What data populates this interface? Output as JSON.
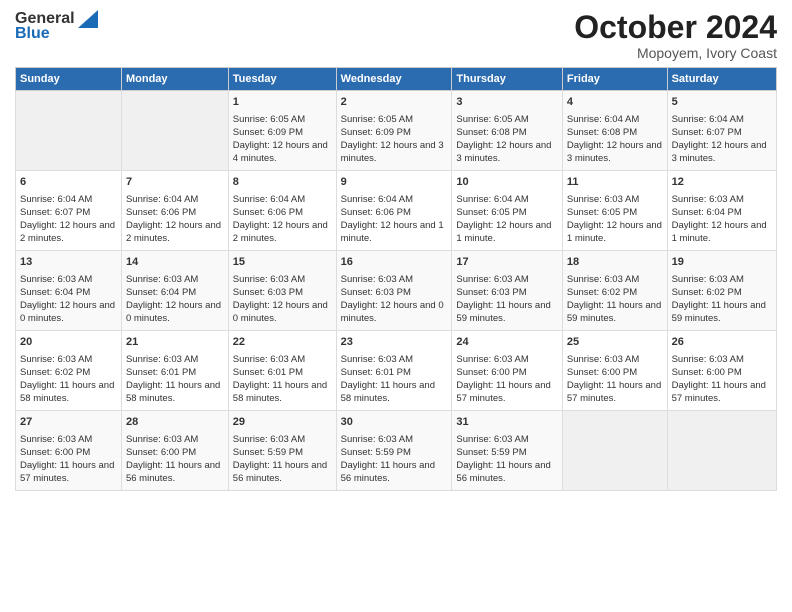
{
  "header": {
    "logo_general": "General",
    "logo_blue": "Blue",
    "title": "October 2024",
    "subtitle": "Mopoyem, Ivory Coast"
  },
  "calendar": {
    "days_of_week": [
      "Sunday",
      "Monday",
      "Tuesday",
      "Wednesday",
      "Thursday",
      "Friday",
      "Saturday"
    ],
    "weeks": [
      [
        {
          "day": "",
          "empty": true
        },
        {
          "day": "",
          "empty": true
        },
        {
          "day": "1",
          "sunrise": "Sunrise: 6:05 AM",
          "sunset": "Sunset: 6:09 PM",
          "daylight": "Daylight: 12 hours and 4 minutes."
        },
        {
          "day": "2",
          "sunrise": "Sunrise: 6:05 AM",
          "sunset": "Sunset: 6:09 PM",
          "daylight": "Daylight: 12 hours and 3 minutes."
        },
        {
          "day": "3",
          "sunrise": "Sunrise: 6:05 AM",
          "sunset": "Sunset: 6:08 PM",
          "daylight": "Daylight: 12 hours and 3 minutes."
        },
        {
          "day": "4",
          "sunrise": "Sunrise: 6:04 AM",
          "sunset": "Sunset: 6:08 PM",
          "daylight": "Daylight: 12 hours and 3 minutes."
        },
        {
          "day": "5",
          "sunrise": "Sunrise: 6:04 AM",
          "sunset": "Sunset: 6:07 PM",
          "daylight": "Daylight: 12 hours and 3 minutes."
        }
      ],
      [
        {
          "day": "6",
          "sunrise": "Sunrise: 6:04 AM",
          "sunset": "Sunset: 6:07 PM",
          "daylight": "Daylight: 12 hours and 2 minutes."
        },
        {
          "day": "7",
          "sunrise": "Sunrise: 6:04 AM",
          "sunset": "Sunset: 6:06 PM",
          "daylight": "Daylight: 12 hours and 2 minutes."
        },
        {
          "day": "8",
          "sunrise": "Sunrise: 6:04 AM",
          "sunset": "Sunset: 6:06 PM",
          "daylight": "Daylight: 12 hours and 2 minutes."
        },
        {
          "day": "9",
          "sunrise": "Sunrise: 6:04 AM",
          "sunset": "Sunset: 6:06 PM",
          "daylight": "Daylight: 12 hours and 1 minute."
        },
        {
          "day": "10",
          "sunrise": "Sunrise: 6:04 AM",
          "sunset": "Sunset: 6:05 PM",
          "daylight": "Daylight: 12 hours and 1 minute."
        },
        {
          "day": "11",
          "sunrise": "Sunrise: 6:03 AM",
          "sunset": "Sunset: 6:05 PM",
          "daylight": "Daylight: 12 hours and 1 minute."
        },
        {
          "day": "12",
          "sunrise": "Sunrise: 6:03 AM",
          "sunset": "Sunset: 6:04 PM",
          "daylight": "Daylight: 12 hours and 1 minute."
        }
      ],
      [
        {
          "day": "13",
          "sunrise": "Sunrise: 6:03 AM",
          "sunset": "Sunset: 6:04 PM",
          "daylight": "Daylight: 12 hours and 0 minutes."
        },
        {
          "day": "14",
          "sunrise": "Sunrise: 6:03 AM",
          "sunset": "Sunset: 6:04 PM",
          "daylight": "Daylight: 12 hours and 0 minutes."
        },
        {
          "day": "15",
          "sunrise": "Sunrise: 6:03 AM",
          "sunset": "Sunset: 6:03 PM",
          "daylight": "Daylight: 12 hours and 0 minutes."
        },
        {
          "day": "16",
          "sunrise": "Sunrise: 6:03 AM",
          "sunset": "Sunset: 6:03 PM",
          "daylight": "Daylight: 12 hours and 0 minutes."
        },
        {
          "day": "17",
          "sunrise": "Sunrise: 6:03 AM",
          "sunset": "Sunset: 6:03 PM",
          "daylight": "Daylight: 11 hours and 59 minutes."
        },
        {
          "day": "18",
          "sunrise": "Sunrise: 6:03 AM",
          "sunset": "Sunset: 6:02 PM",
          "daylight": "Daylight: 11 hours and 59 minutes."
        },
        {
          "day": "19",
          "sunrise": "Sunrise: 6:03 AM",
          "sunset": "Sunset: 6:02 PM",
          "daylight": "Daylight: 11 hours and 59 minutes."
        }
      ],
      [
        {
          "day": "20",
          "sunrise": "Sunrise: 6:03 AM",
          "sunset": "Sunset: 6:02 PM",
          "daylight": "Daylight: 11 hours and 58 minutes."
        },
        {
          "day": "21",
          "sunrise": "Sunrise: 6:03 AM",
          "sunset": "Sunset: 6:01 PM",
          "daylight": "Daylight: 11 hours and 58 minutes."
        },
        {
          "day": "22",
          "sunrise": "Sunrise: 6:03 AM",
          "sunset": "Sunset: 6:01 PM",
          "daylight": "Daylight: 11 hours and 58 minutes."
        },
        {
          "day": "23",
          "sunrise": "Sunrise: 6:03 AM",
          "sunset": "Sunset: 6:01 PM",
          "daylight": "Daylight: 11 hours and 58 minutes."
        },
        {
          "day": "24",
          "sunrise": "Sunrise: 6:03 AM",
          "sunset": "Sunset: 6:00 PM",
          "daylight": "Daylight: 11 hours and 57 minutes."
        },
        {
          "day": "25",
          "sunrise": "Sunrise: 6:03 AM",
          "sunset": "Sunset: 6:00 PM",
          "daylight": "Daylight: 11 hours and 57 minutes."
        },
        {
          "day": "26",
          "sunrise": "Sunrise: 6:03 AM",
          "sunset": "Sunset: 6:00 PM",
          "daylight": "Daylight: 11 hours and 57 minutes."
        }
      ],
      [
        {
          "day": "27",
          "sunrise": "Sunrise: 6:03 AM",
          "sunset": "Sunset: 6:00 PM",
          "daylight": "Daylight: 11 hours and 57 minutes."
        },
        {
          "day": "28",
          "sunrise": "Sunrise: 6:03 AM",
          "sunset": "Sunset: 6:00 PM",
          "daylight": "Daylight: 11 hours and 56 minutes."
        },
        {
          "day": "29",
          "sunrise": "Sunrise: 6:03 AM",
          "sunset": "Sunset: 5:59 PM",
          "daylight": "Daylight: 11 hours and 56 minutes."
        },
        {
          "day": "30",
          "sunrise": "Sunrise: 6:03 AM",
          "sunset": "Sunset: 5:59 PM",
          "daylight": "Daylight: 11 hours and 56 minutes."
        },
        {
          "day": "31",
          "sunrise": "Sunrise: 6:03 AM",
          "sunset": "Sunset: 5:59 PM",
          "daylight": "Daylight: 11 hours and 56 minutes."
        },
        {
          "day": "",
          "empty": true
        },
        {
          "day": "",
          "empty": true
        }
      ]
    ]
  }
}
